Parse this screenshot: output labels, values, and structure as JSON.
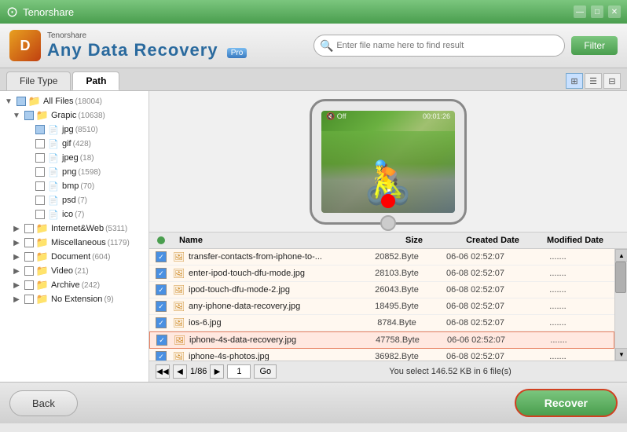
{
  "titlebar": {
    "title": "Tenorshare",
    "logo_text": "T",
    "controls": [
      "minimize",
      "maximize",
      "close"
    ]
  },
  "header": {
    "company": "Tenorshare",
    "app_name": "Any Data Recovery",
    "app_badge": "Pro",
    "search_placeholder": "Enter file name here to find result",
    "filter_label": "Filter"
  },
  "tabs": {
    "items": [
      {
        "id": "file-type",
        "label": "File Type",
        "active": false
      },
      {
        "id": "path",
        "label": "Path",
        "active": true
      }
    ],
    "view_buttons": [
      {
        "id": "grid",
        "icon": "⊞",
        "active": false
      },
      {
        "id": "list",
        "icon": "☰",
        "active": false
      },
      {
        "id": "detail",
        "icon": "⊟",
        "active": false
      }
    ]
  },
  "file_tree": {
    "items": [
      {
        "level": 0,
        "toggle": "▼",
        "checked": "partial",
        "icon": "folder",
        "label": "All Files",
        "count": "(18004)"
      },
      {
        "level": 1,
        "toggle": "▼",
        "checked": "partial",
        "icon": "folder",
        "label": "Grapic",
        "count": "(10638)"
      },
      {
        "level": 2,
        "toggle": "",
        "checked": "partial",
        "icon": "file",
        "label": "jpg",
        "count": "(8510)"
      },
      {
        "level": 2,
        "toggle": "",
        "checked": false,
        "icon": "file",
        "label": "gif",
        "count": "(428)"
      },
      {
        "level": 2,
        "toggle": "",
        "checked": false,
        "icon": "file",
        "label": "jpeg",
        "count": "(18)"
      },
      {
        "level": 2,
        "toggle": "",
        "checked": false,
        "icon": "file",
        "label": "png",
        "count": "(1598)"
      },
      {
        "level": 2,
        "toggle": "",
        "checked": false,
        "icon": "file",
        "label": "bmp",
        "count": "(70)"
      },
      {
        "level": 2,
        "toggle": "",
        "checked": false,
        "icon": "file",
        "label": "psd",
        "count": "(7)"
      },
      {
        "level": 2,
        "toggle": "",
        "checked": false,
        "icon": "file",
        "label": "ico",
        "count": "(7)"
      },
      {
        "level": 1,
        "toggle": "▶",
        "checked": false,
        "icon": "folder",
        "label": "Internet&Web",
        "count": "(5311)"
      },
      {
        "level": 1,
        "toggle": "▶",
        "checked": false,
        "icon": "folder",
        "label": "Miscellaneous",
        "count": "(1179)"
      },
      {
        "level": 1,
        "toggle": "▶",
        "checked": false,
        "icon": "folder",
        "label": "Document",
        "count": "(604)"
      },
      {
        "level": 1,
        "toggle": "▶",
        "checked": false,
        "icon": "folder",
        "label": "Video",
        "count": "(21)"
      },
      {
        "level": 1,
        "toggle": "▶",
        "checked": false,
        "icon": "folder",
        "label": "Archive",
        "count": "(242)"
      },
      {
        "level": 1,
        "toggle": "▶",
        "checked": false,
        "icon": "folder",
        "label": "No Extension",
        "count": "(9)"
      }
    ]
  },
  "file_list": {
    "headers": {
      "name": "Name",
      "size": "Size",
      "created": "Created Date",
      "modified": "Modified Date"
    },
    "rows": [
      {
        "id": 1,
        "checked": true,
        "selected": false,
        "name": "transfer-contacts-from-iphone-to-...",
        "size": "20852.Byte",
        "created": "06-06 02:52:07",
        "modified": "......."
      },
      {
        "id": 2,
        "checked": true,
        "selected": false,
        "name": "enter-ipod-touch-dfu-mode.jpg",
        "size": "28103.Byte",
        "created": "06-08 02:52:07",
        "modified": "......."
      },
      {
        "id": 3,
        "checked": true,
        "selected": false,
        "name": "ipod-touch-dfu-mode-2.jpg",
        "size": "26043.Byte",
        "created": "06-08 02:52:07",
        "modified": "......."
      },
      {
        "id": 4,
        "checked": true,
        "selected": false,
        "name": "any-iphone-data-recovery.jpg",
        "size": "18495.Byte",
        "created": "06-08 02:52:07",
        "modified": "......."
      },
      {
        "id": 5,
        "checked": true,
        "selected": false,
        "name": "ios-6.jpg",
        "size": "8784.Byte",
        "created": "06-08 02:52:07",
        "modified": "......."
      },
      {
        "id": 6,
        "checked": true,
        "selected": true,
        "name": "iphone-4s-data-recovery.jpg",
        "size": "47758.Byte",
        "created": "06-06 02:52:07",
        "modified": "......."
      },
      {
        "id": 7,
        "checked": true,
        "selected": false,
        "name": "iphone-4s-photos.jpg",
        "size": "36982.Byte",
        "created": "06-08 02:52:07",
        "modified": "......."
      }
    ]
  },
  "pagination": {
    "current": "1",
    "total": "86",
    "nav": {
      "first": "◀◀",
      "prev": "◀",
      "next": "▶",
      "go": "Go"
    },
    "status": "You select 146.52 KB in 6 file(s)"
  },
  "footer": {
    "back_label": "Back",
    "recover_label": "Recover"
  },
  "phone_preview": {
    "status_left": "🔇 Off",
    "status_right": "00:01:26"
  }
}
